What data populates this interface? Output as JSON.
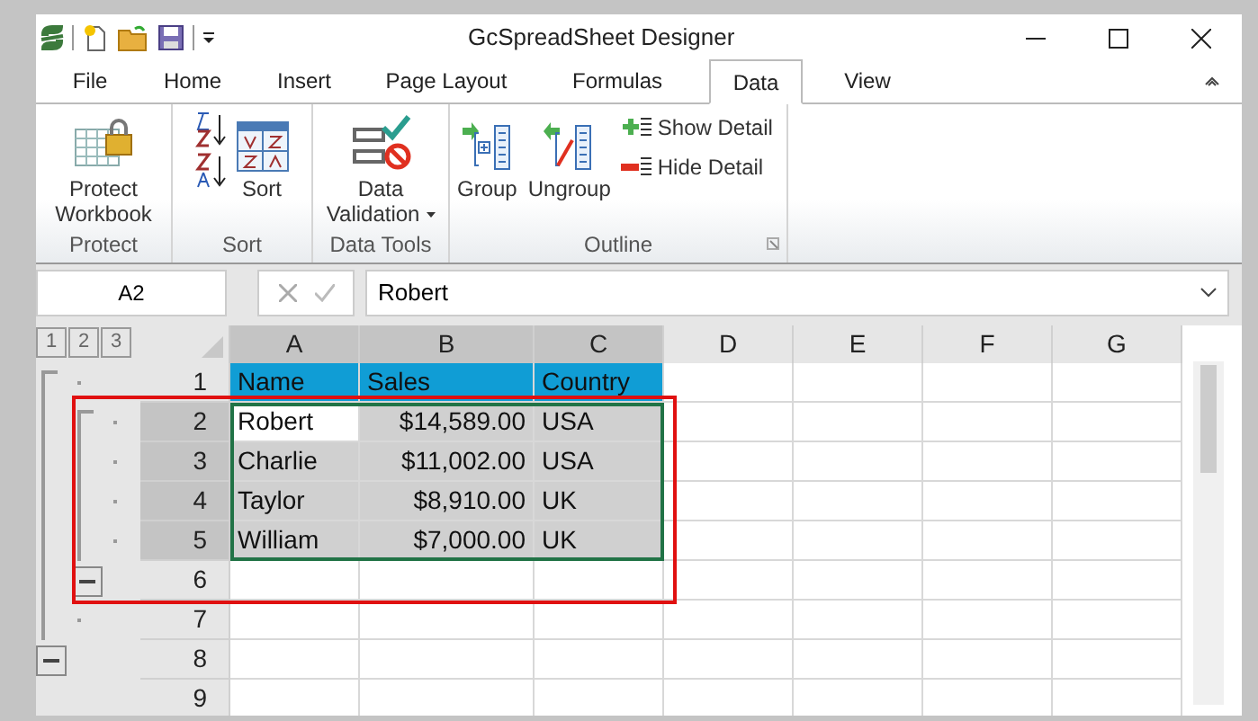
{
  "window": {
    "title": "GcSpreadSheet Designer"
  },
  "tabs": [
    {
      "label": "File",
      "selected": false
    },
    {
      "label": "Home",
      "selected": false
    },
    {
      "label": "Insert",
      "selected": false
    },
    {
      "label": "Page Layout",
      "selected": false
    },
    {
      "label": "Formulas",
      "selected": false
    },
    {
      "label": "Data",
      "selected": true
    },
    {
      "label": "View",
      "selected": false
    }
  ],
  "ribbon_groups": [
    {
      "label": "Protect",
      "buttons": [
        {
          "kind": "large",
          "label": "Protect Workbook"
        }
      ]
    },
    {
      "label": "Sort",
      "buttons": [
        {
          "kind": "stack"
        },
        {
          "kind": "large",
          "label": "Sort"
        }
      ]
    },
    {
      "label": "Data Tools",
      "buttons": [
        {
          "kind": "large",
          "label": "Data Validation",
          "dropdown": true
        }
      ]
    },
    {
      "label": "Outline",
      "launcher": true,
      "buttons": [
        {
          "kind": "large",
          "label": "Group"
        },
        {
          "kind": "large",
          "label": "Ungroup"
        },
        {
          "kind": "small",
          "items": [
            "Show Detail",
            "Hide Detail"
          ]
        }
      ]
    }
  ],
  "formula_bar": {
    "name_box": "A2",
    "formula": "Robert"
  },
  "outline_levels": [
    "1",
    "2",
    "3"
  ],
  "sheet": {
    "columns": [
      "A",
      "B",
      "C",
      "D",
      "E",
      "F",
      "G"
    ],
    "rows": [
      {
        "header": "1",
        "kind": "header",
        "selected": false,
        "cells": [
          "Name",
          "Sales",
          "Country"
        ]
      },
      {
        "header": "2",
        "kind": "data",
        "selected": true,
        "cells": [
          "Robert",
          "$14,589.00",
          "USA"
        ]
      },
      {
        "header": "3",
        "kind": "data",
        "selected": true,
        "cells": [
          "Charlie",
          "$11,002.00",
          "USA"
        ]
      },
      {
        "header": "4",
        "kind": "data",
        "selected": true,
        "cells": [
          "Taylor",
          "$8,910.00",
          "UK"
        ]
      },
      {
        "header": "5",
        "kind": "data",
        "selected": true,
        "cells": [
          "William",
          "$7,000.00",
          "UK"
        ]
      },
      {
        "header": "6",
        "kind": "data",
        "selected": false,
        "cells": []
      },
      {
        "header": "7",
        "kind": "data",
        "selected": false,
        "cells": []
      },
      {
        "header": "8",
        "kind": "data",
        "selected": false,
        "cells": []
      },
      {
        "header": "9",
        "kind": "data",
        "selected": false,
        "cells": []
      }
    ]
  }
}
